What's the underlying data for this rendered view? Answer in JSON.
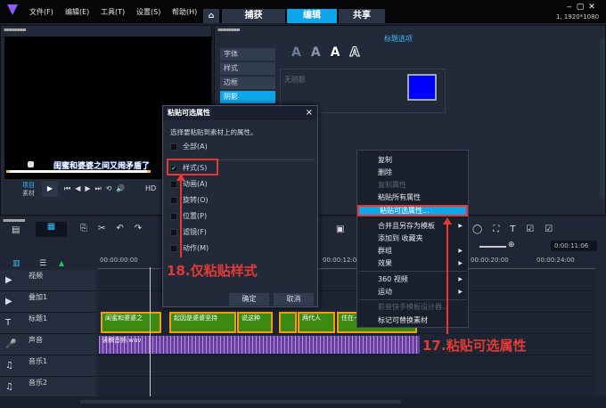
{
  "titlebar": {
    "menus": [
      "文件(F)",
      "编辑(E)",
      "工具(T)",
      "设置(S)",
      "帮助(H)"
    ],
    "tabs": [
      "捕获",
      "编辑",
      "共享"
    ],
    "active_tab": "编辑",
    "resolution": "1, 1920*1080"
  },
  "preview": {
    "subtitle": "闺蜜和婆婆之间又闹矛盾了",
    "mode_project": "项目",
    "mode_clip": "素材",
    "hd": "HD"
  },
  "options": {
    "title": "标题选项",
    "side_tabs": [
      "字体",
      "样式",
      "边框",
      "阴影"
    ],
    "active_side_tab": "阴影",
    "shadow_label": "无阴影",
    "shadow_color": "#0000ff",
    "style_letters": [
      "A",
      "A",
      "A",
      "A"
    ]
  },
  "dialog": {
    "title": "粘贴可选属性",
    "instruction": "选择要粘贴到素材上的属性。",
    "all": "全部(A)",
    "options": [
      {
        "label": "样式(S)",
        "checked": true
      },
      {
        "label": "动画(A)",
        "checked": false
      },
      {
        "label": "旋转(O)",
        "checked": false
      },
      {
        "label": "位置(P)",
        "checked": false
      },
      {
        "label": "滤镜(F)",
        "checked": false
      },
      {
        "label": "动作(M)",
        "checked": false
      }
    ],
    "ok": "确定",
    "cancel": "取消",
    "close": "×"
  },
  "context_menu": {
    "items": [
      {
        "label": "复制"
      },
      {
        "label": "删除"
      },
      {
        "label": "复制属性",
        "disabled": true
      },
      {
        "label": "粘贴所有属性"
      },
      {
        "label": "粘贴可选属性...",
        "highlighted": true
      },
      {
        "label": "合并且另存为模板",
        "submenu": true
      },
      {
        "label": "添加到 收藏夹"
      },
      {
        "label": "群组",
        "submenu": true
      },
      {
        "label": "效果",
        "submenu": true
      },
      {
        "label": "360 视频",
        "submenu": true
      },
      {
        "label": "运动",
        "submenu": true
      },
      {
        "label": "影音快手模板设计器...",
        "disabled": true
      },
      {
        "label": "标记可替换素材"
      }
    ]
  },
  "annotations": {
    "step18": "18.仅粘贴样式",
    "step17": "17.粘贴可选属性"
  },
  "timeline": {
    "timecodes": [
      "00:00:00:00",
      "00:00:12:00",
      "00:00:20:00",
      "00:00:24:00"
    ],
    "current_time": "0:00:11:06",
    "tracks": [
      "视频",
      "叠加1",
      "标题1",
      "声音",
      "音乐1",
      "音乐2"
    ],
    "title_clips": [
      "闺蜜和婆婆之",
      "起因是婆婆坚持",
      "说这种",
      "",
      "两代人",
      "住在一"
    ],
    "audio_clip": "读稿音频.wav"
  }
}
